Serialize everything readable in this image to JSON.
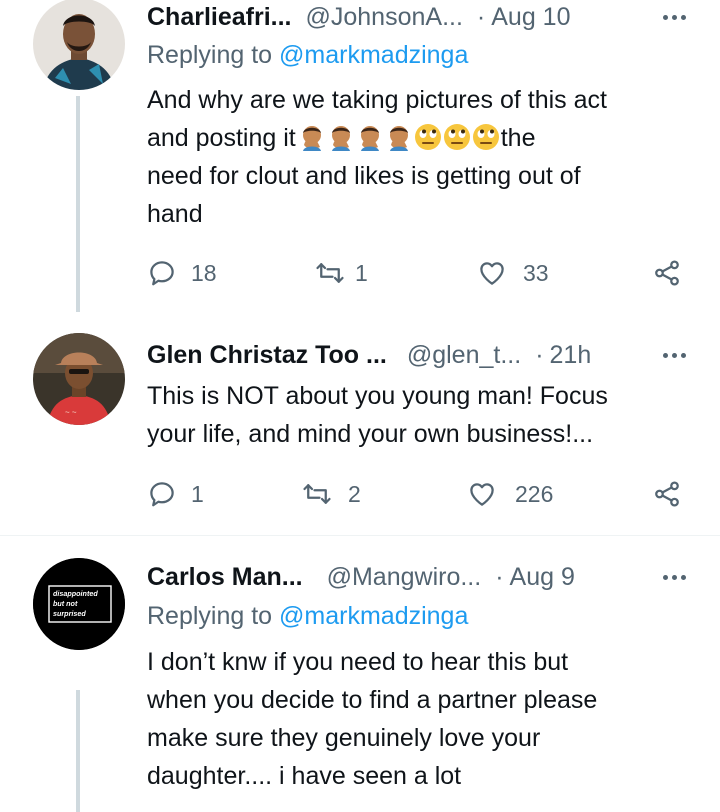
{
  "tweets": [
    {
      "name": "Charlieafri...",
      "handle": "@JohnsonA...",
      "separator": "·",
      "date": "Aug 10",
      "replying_prefix": "Replying to",
      "replying_to": "@markmadzinga",
      "text_lines": [
        "And why are we taking pictures of this act",
        "and posting it",
        "the",
        "need for clout and likes is getting out of",
        "hand"
      ],
      "emojis": [
        "facepalm-emoji",
        "facepalm-emoji",
        "facepalm-emoji",
        "facepalm-emoji",
        "eye-roll-emoji",
        "eye-roll-emoji",
        "eye-roll-emoji"
      ],
      "replies": "18",
      "retweets": "1",
      "likes": "33"
    },
    {
      "name": "Glen Christaz Too ...",
      "handle": "@glen_t...",
      "separator": "·",
      "date": "21h",
      "text_lines": [
        "This is NOT about you young man! Focus",
        "your life, and mind your own business!..."
      ],
      "replies": "1",
      "retweets": "2",
      "likes": "226"
    },
    {
      "name": "Carlos Man...",
      "handle": "@Mangwiro...",
      "separator": "·",
      "date": "Aug 9",
      "replying_prefix": "Replying to",
      "replying_to": "@markmadzinga",
      "avatar_text": [
        "disappointed",
        "but not",
        "surprised"
      ],
      "text_lines": [
        "I don’t knw if you need to hear this but",
        "when you decide to find a partner please",
        "make sure they genuinely love your",
        "daughter.... i have seen a lot"
      ]
    }
  ],
  "icons": {
    "reply": "reply-icon",
    "retweet": "retweet-icon",
    "like": "heart-icon",
    "share": "share-icon",
    "more": "more-icon"
  },
  "colors": {
    "text": "#0f1419",
    "secondary": "#536471",
    "link": "#1d9bf0",
    "thread_line": "#cfd9de",
    "avatar_black": "#000000"
  }
}
